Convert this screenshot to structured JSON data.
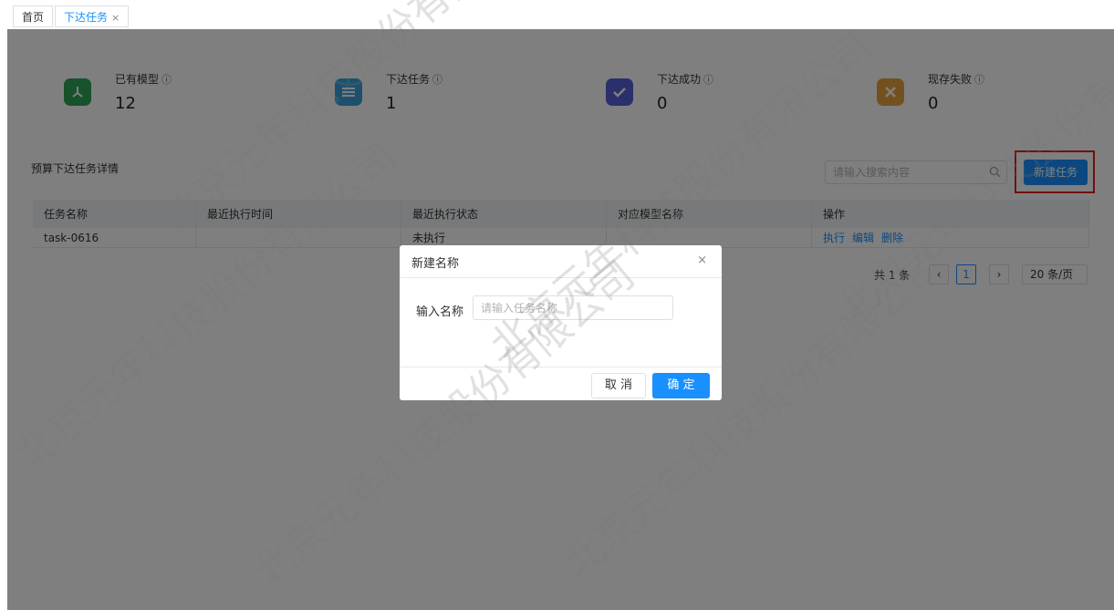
{
  "tabs": [
    {
      "label": "首页"
    },
    {
      "label": "下达任务",
      "close": "×"
    }
  ],
  "cards": [
    {
      "label": "已有模型",
      "info": "ⓘ",
      "value": "12",
      "color": "#2fa45a",
      "icon": "model-icon"
    },
    {
      "label": "下达任务",
      "info": "ⓘ",
      "value": "1",
      "color": "#3aa0d8",
      "icon": "task-list-icon"
    },
    {
      "label": "下达成功",
      "info": "ⓘ",
      "value": "0",
      "color": "#5460d8",
      "icon": "check-icon"
    },
    {
      "label": "现存失败",
      "info": "ⓘ",
      "value": "0",
      "color": "#e6a23c",
      "icon": "fail-icon"
    }
  ],
  "section": {
    "title": "预算下达任务详情"
  },
  "search": {
    "placeholder": "请输入搜索内容"
  },
  "toolbar": {
    "new_label": "新建任务"
  },
  "table": {
    "columns": [
      "任务名称",
      "最近执行时间",
      "最近执行状态",
      "对应模型名称",
      "操作"
    ],
    "rows": [
      {
        "name": "task-0616",
        "time": "",
        "status": "未执行",
        "model": "",
        "ops": [
          "执行",
          "编辑",
          "删除"
        ]
      }
    ]
  },
  "pager": {
    "total": "共 1 条",
    "prev": "‹",
    "current": "1",
    "next": "›",
    "size": "20 条/页"
  },
  "modal": {
    "title": "新建名称",
    "close": "×",
    "field_label": "输入名称",
    "field_placeholder": "请输入任务名称",
    "cancel": "取 消",
    "ok": "确 定"
  },
  "watermark": {
    "text": "北京元年科技股份有限公司"
  }
}
